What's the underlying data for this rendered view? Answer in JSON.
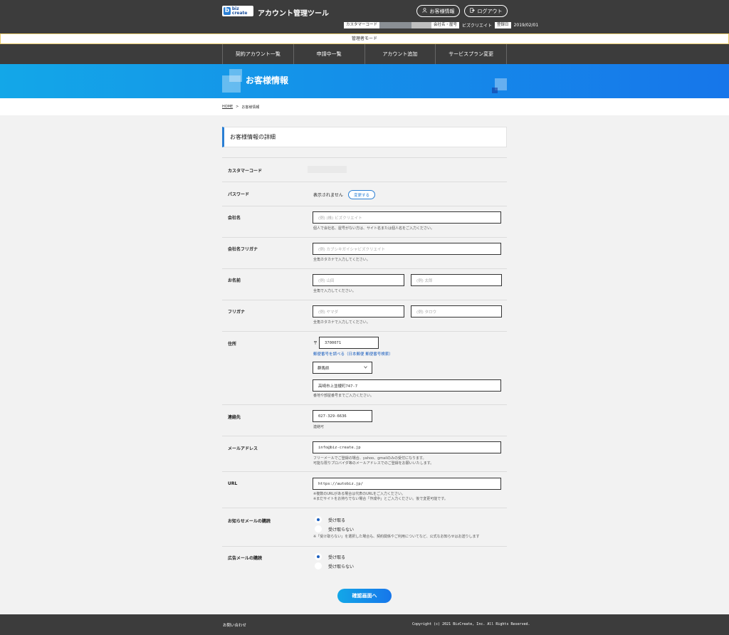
{
  "header": {
    "logo_mark": "b",
    "logo_text": "biz create",
    "app_title": "アカウント管理ツール",
    "customer_info_button": "お客様情報",
    "logout_button": "ログアウト",
    "customer_code_label": "カスタマーコード",
    "company_label": "会社名・屋号",
    "company_value": "ビズクリエイト",
    "registered_label": "登録日",
    "registered_value": "2019/02/01"
  },
  "admin_mode": "管理者モード",
  "nav": {
    "items": [
      "契約アカウント一覧",
      "申請中一覧",
      "アカウント追加",
      "サービスプラン変更"
    ]
  },
  "banner": {
    "title": "お客様情報"
  },
  "breadcrumb": {
    "home": "HOME",
    "sep": ">",
    "current": "お客様情報"
  },
  "section_title": "お客様情報の詳細",
  "form": {
    "customer_code": {
      "label": "カスタマーコード"
    },
    "password": {
      "label": "パスワード",
      "value": "表示されません",
      "change_button": "変更する"
    },
    "company": {
      "label": "会社名",
      "placeholder": "(例) (株) ビズクリエイト",
      "help": "個人で会社名、屋号がない方は、サイト名または個人名をご入力ください。"
    },
    "company_kana": {
      "label": "会社名フリガナ",
      "placeholder": "(例) カブシキガイシャビズクリエイト",
      "help": "全角カタカナで入力してください。"
    },
    "name": {
      "label": "お名前",
      "last_placeholder": "(例) 山田",
      "first_placeholder": "(例) 太郎",
      "help": "全角で入力してください。"
    },
    "name_kana": {
      "label": "フリガナ",
      "last_placeholder": "(例) ヤマダ",
      "first_placeholder": "(例) タロウ",
      "help": "全角カタカナで入力してください。"
    },
    "address": {
      "label": "住所",
      "zip_mark": "〒",
      "zip_value": "3700071",
      "zip_link": "郵便番号を調べる（日本郵便 郵便番号検索）",
      "prefecture": "群馬県",
      "street": "高崎市上並榎町747-7",
      "help": "番地や部屋番号までご入力ください。"
    },
    "phone": {
      "label": "連絡先",
      "value": "027-329-6636",
      "help": "連絡可"
    },
    "email": {
      "label": "メールアドレス",
      "value": "info@biz-create.jp",
      "help1": "フリーメールでご登録の場合、yahoo、gmailのみの受付になります。",
      "help2": "可能な限りプロバイダ等のメールアドレスでのご登録をお願いいたします。"
    },
    "url": {
      "label": "URL",
      "value": "https://autobiz.jp/",
      "help1": "※複数のURLがある場合は代表のURLをご入力ください。",
      "help2": "※まだサイトをお持ちでない場合「作成中」とご入力ください。後で変更可能です。"
    },
    "notice_mail": {
      "label": "お知らせメールの購読",
      "opt1": "受け取る",
      "opt2": "受け取らない",
      "help": "※「受け取らない」を選択した場合も、契約関係やご利用についてなど、公式なお知らせはお送りします"
    },
    "ad_mail": {
      "label": "広告メールの購読",
      "opt1": "受け取る",
      "opt2": "受け取らない"
    }
  },
  "submit_button": "確認画面へ",
  "footer": {
    "contact": "お問い合わせ",
    "copyright": "Copyright (c) 2021 BizCreate, Inc. All Rights Reserved."
  }
}
